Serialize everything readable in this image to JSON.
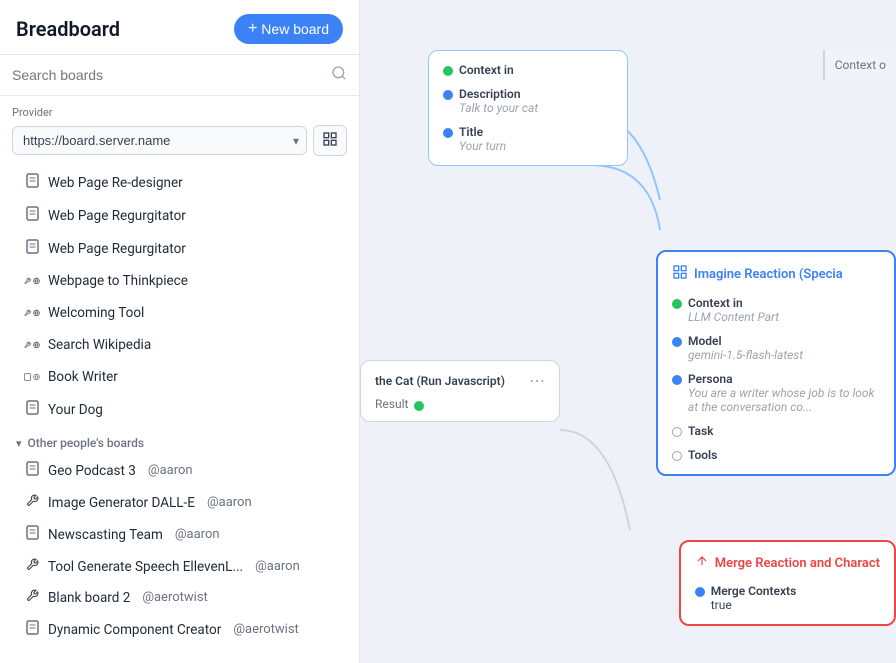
{
  "sidebar": {
    "title": "Breadboard",
    "new_board_label": "+ New board",
    "new_board_plus": "+",
    "new_board_text": "New board",
    "search_placeholder": "Search boards",
    "provider": {
      "label": "Provider",
      "value": "https://board.server.name",
      "options": [
        "https://board.server.name"
      ]
    },
    "my_boards": [
      {
        "id": 1,
        "name": "Web Page Re-designer",
        "type": "doc",
        "icon": "📄"
      },
      {
        "id": 2,
        "name": "Web Page Regurgitator",
        "type": "doc",
        "icon": "📄"
      },
      {
        "id": 3,
        "name": "Web Page Regurgitator",
        "type": "doc",
        "icon": "📄"
      },
      {
        "id": 4,
        "name": "Webpage to Thinkpiece",
        "type": "tool",
        "icon": "🔧🌐"
      },
      {
        "id": 5,
        "name": "Welcoming Tool",
        "type": "tool",
        "icon": "🔧🌍"
      },
      {
        "id": 6,
        "name": "Search Wikipedia",
        "type": "tool",
        "icon": "🔧🌍"
      },
      {
        "id": 7,
        "name": "Book Writer",
        "type": "doc",
        "icon": "📄🌍"
      },
      {
        "id": 8,
        "name": "Your Dog",
        "type": "doc",
        "icon": "📄"
      }
    ],
    "other_section_label": "Other people's boards",
    "other_boards": [
      {
        "id": 1,
        "name": "Geo Podcast 3",
        "author": "@aaron",
        "type": "doc"
      },
      {
        "id": 2,
        "name": "Image Generator DALL-E",
        "author": "@aaron",
        "type": "tool"
      },
      {
        "id": 3,
        "name": "Newscasting Team",
        "author": "@aaron",
        "type": "doc"
      },
      {
        "id": 4,
        "name": "Tool Generate Speech EllevenL...",
        "author": "@aaron",
        "type": "tool"
      },
      {
        "id": 5,
        "name": "Blank board 2",
        "author": "@aerotwist",
        "type": "tool"
      },
      {
        "id": 6,
        "name": "Dynamic Component Creator",
        "author": "@aerotwist",
        "type": "doc"
      }
    ]
  },
  "canvas": {
    "top_card": {
      "fields": [
        {
          "label": "Context in",
          "value": "",
          "dot": "green"
        },
        {
          "label": "Description",
          "value": "Talk to your cat",
          "dot": "blue"
        },
        {
          "label": "Title",
          "value": "Your turn",
          "dot": "blue"
        }
      ]
    },
    "js_node": {
      "title": "the Cat (Run Javascript)",
      "result_label": "Result",
      "result_dot": "green"
    },
    "imagine_node": {
      "title": "Imagine Reaction (Specia",
      "fields": [
        {
          "label": "Context in",
          "value": "LLM Content Part",
          "dot": "green"
        },
        {
          "label": "Model",
          "value": "gemini-1.5-flash-latest",
          "dot": "blue"
        },
        {
          "label": "Persona",
          "value": "You are a writer whose job is to look at the conversation co...",
          "dot": "blue"
        },
        {
          "label": "Task",
          "value": "",
          "dot": "gray"
        },
        {
          "label": "Tools",
          "value": "",
          "dot": "gray"
        }
      ]
    },
    "merge_node": {
      "title": "Merge Reaction and Charact",
      "fields": [
        {
          "label": "Merge Contexts",
          "value": "true",
          "dot": "blue"
        }
      ]
    },
    "right_overflow_label": "Context o"
  },
  "icons": {
    "plus": "+",
    "search": "⌕",
    "delete": "🗑",
    "chevron_down": "▾",
    "chevron_left": "◀",
    "external": "⬡",
    "doc": "📄",
    "tool": "🔧",
    "globe": "🌐",
    "more": "⋯",
    "special": "⊞",
    "merge": "↑",
    "folder": "⊟"
  }
}
